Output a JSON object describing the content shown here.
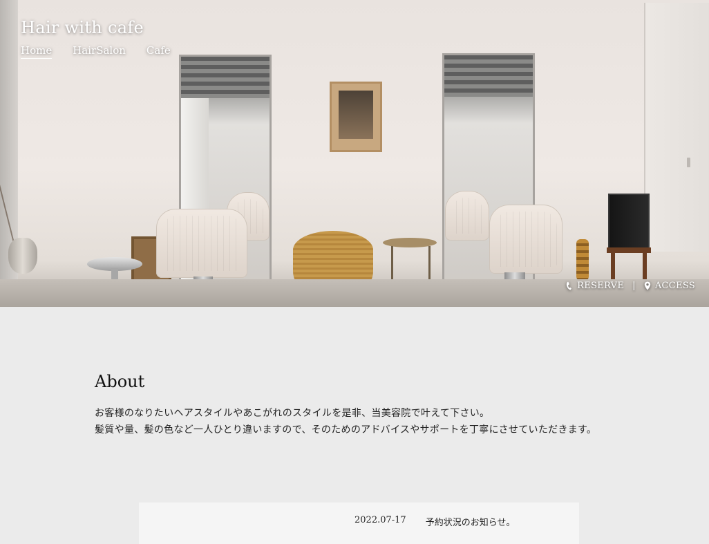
{
  "header": {
    "brand": "Hair with cafe",
    "nav": [
      {
        "label": "Home",
        "active": true
      },
      {
        "label": "HairSalon",
        "active": false
      },
      {
        "label": "Cafe",
        "active": false
      }
    ]
  },
  "hero": {
    "image": "salon-interior-photo"
  },
  "quick_links": {
    "reserve": {
      "label": "RESERVE",
      "icon": "phone-icon"
    },
    "separator": "|",
    "access": {
      "label": "ACCESS",
      "icon": "map-pin-icon"
    }
  },
  "about": {
    "title": "About",
    "lines": [
      "お客様のなりたいヘアスタイルやあこがれのスタイルを是非、当美容院で叶えて下さい。",
      "髪質や量、髪の色など一人ひとり違いますので、そのためのアドバイスやサポートを丁寧にさせていただきます。"
    ]
  },
  "news": {
    "items": [
      {
        "date": "2022.07-17",
        "title": "予約状況のお知らせ。"
      }
    ]
  },
  "colors": {
    "page_bg": "#ebebeb",
    "news_bg": "#f5f5f5",
    "nav_text": "#ffffff"
  }
}
